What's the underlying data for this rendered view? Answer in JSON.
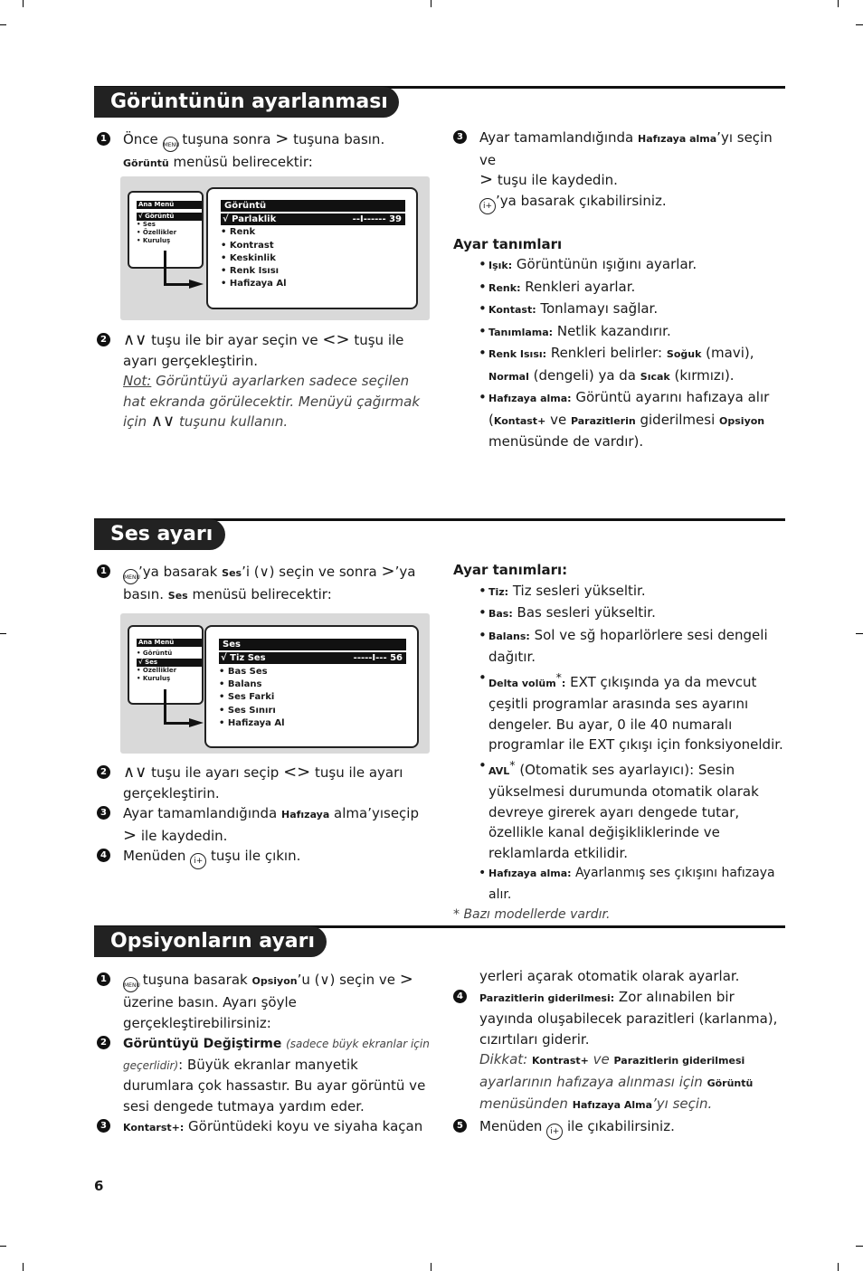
{
  "page_number": "6",
  "sections": {
    "picture": {
      "title": "Görüntünün ayarlanması",
      "step1": {
        "num": "1",
        "a": "Önce",
        "key": "MENU",
        "b": "tuşuna sonra",
        "arrow": ">",
        "c": "tuşuna basın.",
        "d_bold": "Görüntü",
        "d": "menüsü belirecektir:"
      },
      "osd": {
        "main_title": "Ana Menü",
        "main_items": [
          "√ Görüntü",
          "• Ses",
          "• Özellikler",
          "• Kuruluş"
        ],
        "sub_title": "Görüntü",
        "selected_label": "√ Parlaklik",
        "selected_value": "--I------ 39",
        "sub_items": [
          "• Renk",
          "• Kontrast",
          "• Keskinlik",
          "• Renk Isısı",
          "• Hafizaya Al"
        ]
      },
      "step2": {
        "num": "2",
        "updown": "∧∨",
        "a": "tuşu ile bir ayar seçin ve",
        "lr": "<>",
        "b": "tuşu ile ayarı gerçekleştirin.",
        "note_label": "Not:",
        "note": "Görüntüyü ayarlarken sadece seçilen hat ekranda görülecektir. Menüyü çağırmak için",
        "note_updown": "∧∨",
        "note_end": "tuşunu kullanın."
      },
      "step3": {
        "num": "3",
        "a": "Ayar tamamlandığında",
        "a_bold": "Hafızaya alma",
        "b": "’yı seçin ve",
        "arrow": ">",
        "c": "tuşu ile kaydedin.",
        "key": "i+",
        "d": "’ya basarak çıkabilirsiniz."
      },
      "defs_title": "Ayar tanımları",
      "defs": [
        {
          "term": "Işık:",
          "text": "Görüntünün ışığını ayarlar."
        },
        {
          "term": "Renk:",
          "text": "Renkleri ayarlar."
        },
        {
          "term": "Kontast:",
          "text": "Tonlamayı sağlar."
        },
        {
          "term": "Tanımlama:",
          "text": "Netlik kazandırır."
        },
        {
          "term": "Renk Isısı:",
          "text": "Renkleri belirler:",
          "t2": "Soğuk",
          "x2": "(mavi),",
          "t3": "Normal",
          "x3": "(dengeli) ya da",
          "t4": "Sıcak",
          "x4": "(kırmızı)."
        },
        {
          "term": "Hafızaya alma:",
          "text": "Görüntü ayarını hafızaya alır (",
          "t2": "Kontast+",
          "x2": "ve",
          "t3": "Parazitlerin",
          "x3": "giderilmesi",
          "t4": "Opsiyon",
          "x4": "menüsünde de vardır)."
        }
      ]
    },
    "sound": {
      "title": "Ses ayarı",
      "step1": {
        "num": "1",
        "key": "MENU",
        "a": "’ya basarak",
        "a_bold": "Ses",
        "b": "’i (∨) seçin ve sonra",
        "arrow": ">",
        "c": "’ya basın.",
        "d_bold": "Ses",
        "d": "menüsü belirecektir:"
      },
      "osd": {
        "main_title": "Ana Menü",
        "main_items": [
          "• Görüntü",
          "√ Ses",
          "• Özellikler",
          "• Kuruluş"
        ],
        "sub_title": "Ses",
        "selected_label": "√ Tiz Ses",
        "selected_value": "-----I--- 56",
        "sub_items": [
          "• Bas Ses",
          "• Balans",
          "• Ses Farki",
          "• Ses Sınırı",
          "• Hafizaya Al"
        ]
      },
      "step2": {
        "num": "2",
        "updown": "∧∨",
        "a": "tuşu ile ayarı seçip",
        "lr": "<>",
        "b": "tuşu ile ayarı gerçekleştirin."
      },
      "step3": {
        "num": "3",
        "a": "Ayar tamamlandığında",
        "a_bold": "Hafızaya",
        "b": "alma’yıseçip",
        "arrow": ">",
        "c": "ile kaydedin."
      },
      "step4": {
        "num": "4",
        "a": "Menüden",
        "key": "i+",
        "b": "tuşu ile çıkın."
      },
      "defs_title": "Ayar tanımları:",
      "defs": [
        {
          "term": "Tiz:",
          "text": "Tiz sesleri yükseltir."
        },
        {
          "term": "Bas:",
          "text": "Bas sesleri yükseltir."
        },
        {
          "term": "Balans:",
          "text": "Sol ve sğ hoparlörlere sesi dengeli dağıtır."
        },
        {
          "term": "Delta volüm",
          "sup": "*",
          "colon": ":",
          "text": "EXT çıkışında ya da mevcut çeşitli programlar arasında ses ayarını dengeler. Bu ayar, 0 ile 40 numaralı programlar ile EXT çıkışı için fonksiyoneldir."
        },
        {
          "term": "AVL",
          "sup": "*",
          "text": "(Otomatik ses ayarlayıcı): Sesin yükselmesi durumunda otomatik olarak devreye girerek ayarı dengede tutar, özellikle kanal değişikliklerinde ve reklamlarda etkilidir."
        },
        {
          "term": "Hafızaya alma:",
          "text": "Ayarlanmış ses çıkışını hafızaya alır."
        }
      ],
      "footnote": "* Bazı modellerde vardır."
    },
    "options": {
      "title": "Opsiyonların ayarı",
      "step1": {
        "num": "1",
        "key": "MENU",
        "a": "tuşuna basarak",
        "a_bold": "Opsiyon",
        "b": "’u (∨) seçin ve",
        "arrow": ">",
        "c": "üzerine basın. Ayarı şöyle gerçekleştirebilirsiniz:"
      },
      "step2": {
        "num": "2",
        "a_bold": "Görüntüyü Değiştirme",
        "note": "(sadece büyk ekranlar için geçerlidir)",
        "b": ": Büyük ekranlar manyetik durumlara çok hassastır. Bu ayar görüntü ve sesi dengede tutmaya yardım eder."
      },
      "step3": {
        "num": "3",
        "a_bold": "Kontarst+:",
        "b": "Görüntüdeki koyu ve siyaha kaçan",
        "c": "yerleri açarak otomatik olarak ayarlar."
      },
      "step4": {
        "num": "4",
        "a_bold": "Parazitlerin giderilmesi:",
        "b": "Zor alınabilen bir yayında oluşabilecek parazitleri (karlanma), cızırtıları giderir.",
        "n1": "Dikkat:",
        "n1b": "Kontrast+",
        "n2": "ve",
        "n2b": "Parazitlerin giderilmesi",
        "n3": "ayarlarının hafızaya alınması için",
        "n3b": "Görüntü",
        "n4": "menüsünden",
        "n4b": "Hafızaya Alma",
        "n5": "’yı seçin."
      },
      "step5": {
        "num": "5",
        "a": "Menüden",
        "key": "i+",
        "b": "ile çıkabilirsiniz."
      }
    }
  }
}
